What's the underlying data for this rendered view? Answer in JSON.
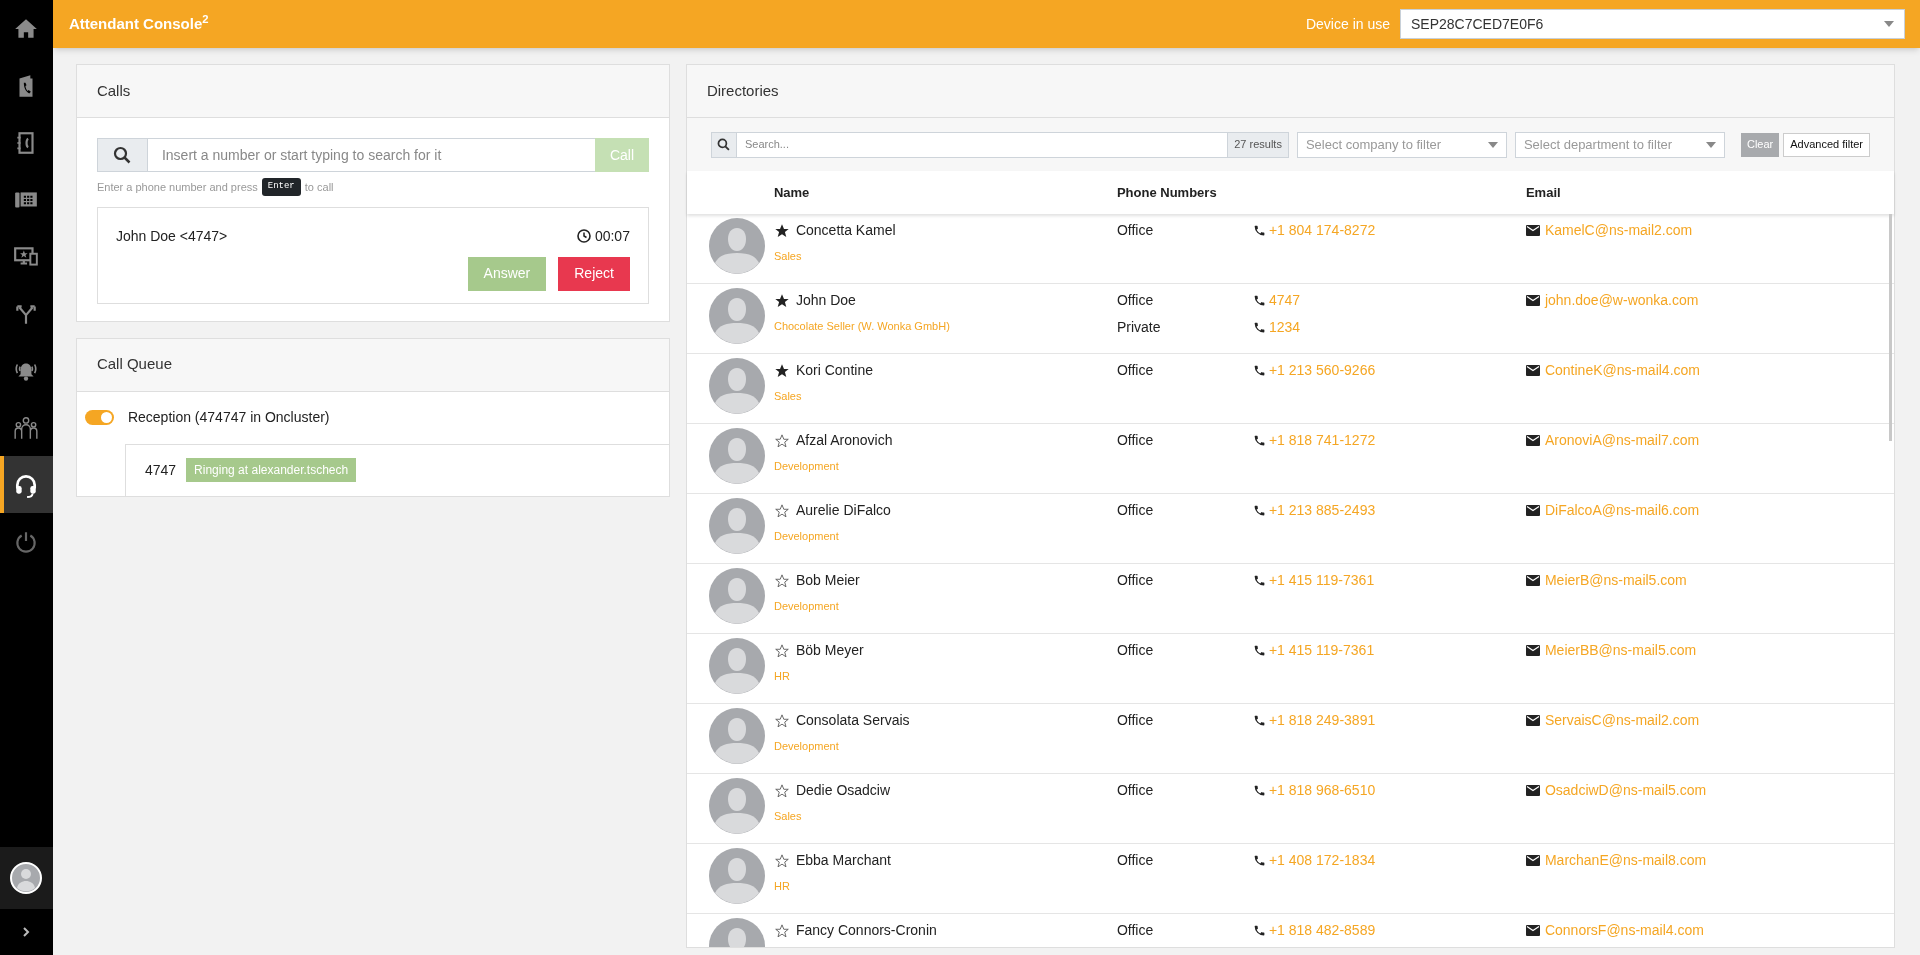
{
  "sidebar": {
    "items": [
      {
        "kind": "home",
        "selected": false
      },
      {
        "kind": "phonebook",
        "selected": false
      },
      {
        "kind": "contacts",
        "selected": false
      },
      {
        "kind": "keypad",
        "selected": false
      },
      {
        "kind": "monitor",
        "selected": false
      },
      {
        "kind": "split",
        "selected": false
      },
      {
        "kind": "alarm",
        "selected": false
      },
      {
        "kind": "group",
        "selected": false
      },
      {
        "kind": "headset",
        "selected": true
      },
      {
        "kind": "power",
        "selected": false
      }
    ]
  },
  "header": {
    "title": "Attendant Console$^{2}$",
    "device_label": "Device in use",
    "device_value": "SEP28C7CED7E0F6"
  },
  "calls": {
    "title": "Calls",
    "dial_placeholder": "Insert a number or start typing to search for it",
    "call_button": "Call",
    "hint_before": "Enter a phone number and press",
    "hint_key": "Enter",
    "hint_after": "to call",
    "active_call": {
      "caller": "John Doe <4747>",
      "duration": "00:07",
      "answer": "Answer",
      "reject": "Reject"
    }
  },
  "call_queue": {
    "title": "Call Queue",
    "queues": [
      {
        "name": "Reception (474747 in Oncluster)",
        "on": true,
        "entries": [
          {
            "number": "4747",
            "status": "Ringing at alexander.tschech"
          }
        ]
      }
    ]
  },
  "directories": {
    "title": "Directories",
    "search_placeholder": "Search...",
    "results": "27 results",
    "company_filter": "Select company to filter",
    "department_filter": "Select department to filter",
    "clear": "Clear",
    "advanced_filter": "Advanced filter",
    "columns": [
      "Name",
      "Phone Numbers",
      "Email"
    ],
    "rows": [
      {
        "name": "Concetta Kamel",
        "favorite": true,
        "department": "Sales",
        "phones": [
          {
            "type": "Office",
            "number": "+1 804 174-8272"
          }
        ],
        "email": "KamelC@ns-mail2.com"
      },
      {
        "name": "John Doe",
        "favorite": true,
        "department": "Chocolate Seller (W. Wonka GmbH)",
        "phones": [
          {
            "type": "Office",
            "number": "4747"
          },
          {
            "type": "Private",
            "number": "1234"
          }
        ],
        "email": "john.doe@w-wonka.com"
      },
      {
        "name": "Kori Contine",
        "favorite": true,
        "department": "Sales",
        "phones": [
          {
            "type": "Office",
            "number": "+1 213 560-9266"
          }
        ],
        "email": "ContineK@ns-mail4.com"
      },
      {
        "name": "Afzal Aronovich",
        "favorite": false,
        "department": "Development",
        "phones": [
          {
            "type": "Office",
            "number": "+1 818 741-1272"
          }
        ],
        "email": "AronoviA@ns-mail7.com"
      },
      {
        "name": "Aurelie DiFalco",
        "favorite": false,
        "department": "Development",
        "phones": [
          {
            "type": "Office",
            "number": "+1 213 885-2493"
          }
        ],
        "email": "DiFalcoA@ns-mail6.com"
      },
      {
        "name": "Bob Meier",
        "favorite": false,
        "department": "Development",
        "phones": [
          {
            "type": "Office",
            "number": "+1 415 119-7361"
          }
        ],
        "email": "MeierB@ns-mail5.com"
      },
      {
        "name": "Böb Meyer",
        "favorite": false,
        "department": "HR",
        "phones": [
          {
            "type": "Office",
            "number": "+1 415 119-7361"
          }
        ],
        "email": "MeierBB@ns-mail5.com"
      },
      {
        "name": "Consolata Servais",
        "favorite": false,
        "department": "Development",
        "phones": [
          {
            "type": "Office",
            "number": "+1 818 249-3891"
          }
        ],
        "email": "ServaisC@ns-mail2.com"
      },
      {
        "name": "Dedie Osadciw",
        "favorite": false,
        "department": "Sales",
        "phones": [
          {
            "type": "Office",
            "number": "+1 818 968-6510"
          }
        ],
        "email": "OsadciwD@ns-mail5.com"
      },
      {
        "name": "Ebba Marchant",
        "favorite": false,
        "department": "HR",
        "phones": [
          {
            "type": "Office",
            "number": "+1 408 172-1834"
          }
        ],
        "email": "MarchanE@ns-mail8.com"
      },
      {
        "name": "Fancy Connors-Cronin",
        "favorite": false,
        "phones": [
          {
            "type": "Office",
            "number": "+1 818 482-8589"
          }
        ],
        "email": "ConnorsF@ns-mail4.com"
      }
    ]
  }
}
